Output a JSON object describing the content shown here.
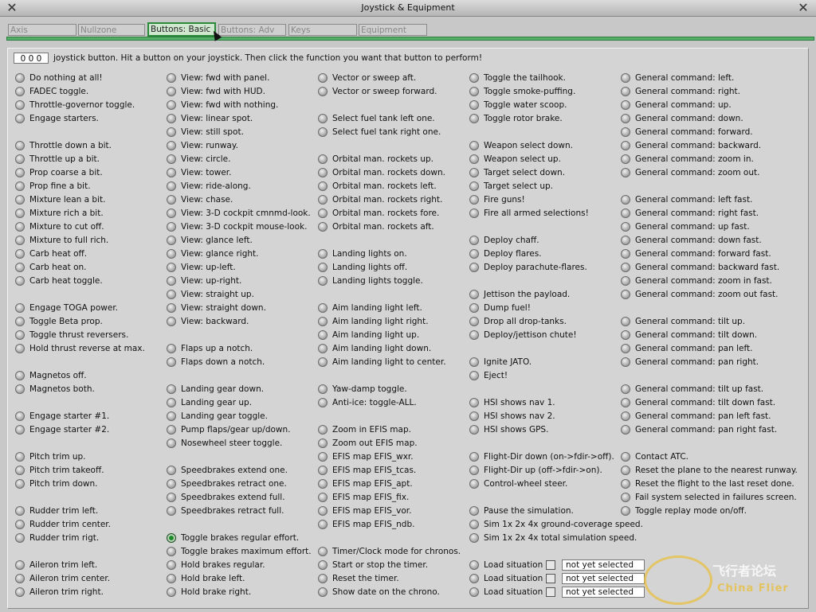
{
  "window": {
    "title": "Joystick & Equipment"
  },
  "tabs": [
    {
      "label": "Axis",
      "active": false
    },
    {
      "label": "Nullzone",
      "active": false
    },
    {
      "label": "Buttons: Basic",
      "active": true
    },
    {
      "label": "Buttons: Adv",
      "active": false
    },
    {
      "label": "Keys",
      "active": false
    },
    {
      "label": "Equipment",
      "active": false
    }
  ],
  "button_number": "0 0 0",
  "instruction": "joystick button. Hit a button on your joystick. Then click the function you want that button to perform!",
  "selected_function": "Toggle brakes regular effort.",
  "columns": [
    [
      "Do nothing at all!",
      "FADEC toggle.",
      "Throttle-governor toggle.",
      "Engage starters.",
      "",
      "Throttle down a bit.",
      "Throttle up a bit.",
      "Prop coarse a bit.",
      "Prop fine a bit.",
      "Mixture lean a bit.",
      "Mixture rich a bit.",
      "Mixture to cut off.",
      "Mixture to full rich.",
      "Carb heat off.",
      "Carb heat on.",
      "Carb heat toggle.",
      "",
      "Engage TOGA power.",
      "Toggle Beta prop.",
      "Toggle thrust reversers.",
      "Hold thrust reverse at max.",
      "",
      "Magnetos off.",
      "Magnetos both.",
      "",
      "Engage starter #1.",
      "Engage starter #2.",
      "",
      "Pitch trim up.",
      "Pitch trim takeoff.",
      "Pitch trim down.",
      "",
      "Rudder trim left.",
      "Rudder trim center.",
      "Rudder trim rigt.",
      "",
      "Aileron trim left.",
      "Aileron trim center.",
      "Aileron trim right."
    ],
    [
      "View: fwd with panel.",
      "View: fwd with HUD.",
      "View: fwd with nothing.",
      "View: linear spot.",
      "View: still spot.",
      "View: runway.",
      "View: circle.",
      "View: tower.",
      "View: ride-along.",
      "View: chase.",
      "View: 3-D cockpit cmnmd-look.",
      "View: 3-D cockpit mouse-look.",
      "View: glance left.",
      "View: glance right.",
      "View: up-left.",
      "View: up-right.",
      "View: straight up.",
      "View: straight down.",
      "View: backward.",
      "",
      "Flaps up a notch.",
      "Flaps down a notch.",
      "",
      "Landing gear down.",
      "Landing gear up.",
      "Landing gear toggle.",
      "Pump flaps/gear up/down.",
      "Nosewheel steer toggle.",
      "",
      "Speedbrakes extend one.",
      "Speedbrakes retract one.",
      "Speedbrakes extend full.",
      "Speedbrakes retract full.",
      "",
      "Toggle brakes regular effort.",
      "Toggle brakes maximum effort.",
      "Hold brakes regular.",
      "Hold brake left.",
      "Hold brake right."
    ],
    [
      "Vector or sweep aft.",
      "Vector or sweep forward.",
      "",
      "Select fuel tank left one.",
      "Select fuel tank right one.",
      "",
      "Orbital man. rockets up.",
      "Orbital man. rockets down.",
      "Orbital man. rockets left.",
      "Orbital man. rockets right.",
      "Orbital man. rockets fore.",
      "Orbital man. rockets aft.",
      "",
      "Landing lights on.",
      "Landing lights off.",
      "Landing lights toggle.",
      "",
      "Aim landing light left.",
      "Aim landing light right.",
      "Aim landing light up.",
      "Aim landing light down.",
      "Aim landing light to center.",
      "",
      "Yaw-damp toggle.",
      "Anti-ice: toggle-ALL.",
      "",
      "Zoom in EFIS map.",
      "Zoom out EFIS map.",
      "EFIS map EFIS_wxr.",
      "EFIS map EFIS_tcas.",
      "EFIS map EFIS_apt.",
      "EFIS map EFIS_fix.",
      "EFIS map EFIS_vor.",
      "EFIS map EFIS_ndb.",
      "",
      "Timer/Clock mode for chronos.",
      "Start or stop the timer.",
      "Reset the timer.",
      "Show date on the chrono."
    ],
    [
      "Toggle the tailhook.",
      "Toggle smoke-puffing.",
      "Toggle water scoop.",
      "Toggle rotor brake.",
      "",
      "Weapon select down.",
      "Weapon select up.",
      "Target select down.",
      "Target select up.",
      "Fire guns!",
      "Fire all armed selections!",
      "",
      "Deploy chaff.",
      "Deploy flares.",
      "Deploy parachute-flares.",
      "",
      "Jettison the payload.",
      "Dump fuel!",
      "Drop all drop-tanks.",
      "Deploy/jettison chute!",
      "",
      "Ignite JATO.",
      "Eject!",
      "",
      "HSI shows nav 1.",
      "HSI shows nav 2.",
      "HSI shows GPS.",
      "",
      "Flight-Dir down (on->fdir->off).",
      "Flight-Dir up (off->fdir->on).",
      "Control-wheel steer.",
      "",
      "Pause the simulation.",
      "Sim 1x 2x 4x ground-coverage speed.",
      "Sim 1x 2x 4x total simulation speed.",
      "",
      "Load situation",
      "Load situation",
      "Load situation"
    ],
    [
      "General command: left.",
      "General command: right.",
      "General command: up.",
      "General command: down.",
      "General command: forward.",
      "General command: backward.",
      "General command: zoom in.",
      "General command: zoom out.",
      "",
      "General command: left fast.",
      "General command: right fast.",
      "General command: up fast.",
      "General command: down fast.",
      "General command: forward fast.",
      "General command: backward fast.",
      "General command: zoom in fast.",
      "General command: zoom out fast.",
      "",
      "General command: tilt up.",
      "General command: tilt down.",
      "General command: pan left.",
      "General command: pan right.",
      "",
      "General command: tilt up fast.",
      "General command: tilt down fast.",
      "General command: pan left fast.",
      "General command: pan right fast.",
      "",
      "Contact ATC.",
      "Reset the plane to the nearest runway.",
      "Reset the flight to the last reset done.",
      "Fail system selected in failures screen.",
      "Toggle replay mode on/off."
    ]
  ],
  "situation_selects": [
    "not yet selected",
    "not yet selected",
    "not yet selected"
  ],
  "watermark": {
    "cn": "飞行者论坛",
    "en": "China Flier"
  }
}
